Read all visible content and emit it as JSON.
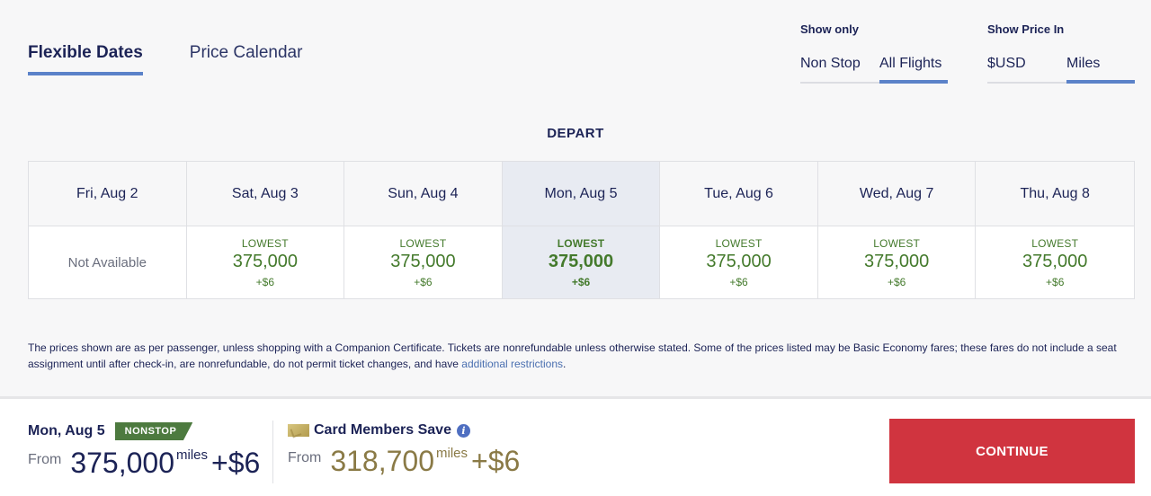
{
  "view_tabs": [
    {
      "label": "Flexible Dates",
      "active": true
    },
    {
      "label": "Price Calendar",
      "active": false
    }
  ],
  "show_only": {
    "label": "Show only",
    "options": [
      "Non Stop",
      "All Flights"
    ],
    "selected": "All Flights"
  },
  "show_price_in": {
    "label": "Show Price In",
    "options": [
      "$USD",
      "Miles"
    ],
    "selected": "Miles"
  },
  "depart_title": "DEPART",
  "dates": [
    {
      "label": "Fri, Aug 2",
      "available": false,
      "status": "Not Available"
    },
    {
      "label": "Sat, Aug 3",
      "available": true,
      "tag": "LOWEST",
      "miles": "375,000",
      "fee": "+$6"
    },
    {
      "label": "Sun, Aug 4",
      "available": true,
      "tag": "LOWEST",
      "miles": "375,000",
      "fee": "+$6"
    },
    {
      "label": "Mon, Aug 5",
      "available": true,
      "tag": "LOWEST",
      "miles": "375,000",
      "fee": "+$6",
      "selected": true
    },
    {
      "label": "Tue, Aug 6",
      "available": true,
      "tag": "LOWEST",
      "miles": "375,000",
      "fee": "+$6"
    },
    {
      "label": "Wed, Aug 7",
      "available": true,
      "tag": "LOWEST",
      "miles": "375,000",
      "fee": "+$6"
    },
    {
      "label": "Thu, Aug 8",
      "available": true,
      "tag": "LOWEST",
      "miles": "375,000",
      "fee": "+$6"
    }
  ],
  "disclaimer": {
    "text": "The prices shown are as per passenger, unless shopping with a Companion Certificate. Tickets are nonrefundable unless otherwise stated. Some of the prices listed may be Basic Economy fares; these fares do not include a seat assignment until after check-in, are nonrefundable, do not permit ticket changes, and have ",
    "link": "additional restrictions",
    "end": "."
  },
  "footer": {
    "selected_date": "Mon, Aug 5",
    "badge": "NONSTOP",
    "from_label": "From",
    "miles": "375,000",
    "unit": "miles",
    "fee": "+$6",
    "card": {
      "label": "Card Members Save",
      "from_label": "From",
      "miles": "318,700",
      "unit": "miles",
      "fee": "+$6"
    },
    "continue_label": "CONTINUE"
  },
  "colors": {
    "accent": "#5b82c9",
    "navy": "#1c2356",
    "green": "#447a2c",
    "gold": "#8a7a46",
    "continue_red": "#d0343f",
    "badge_green": "#4d7a3f"
  }
}
